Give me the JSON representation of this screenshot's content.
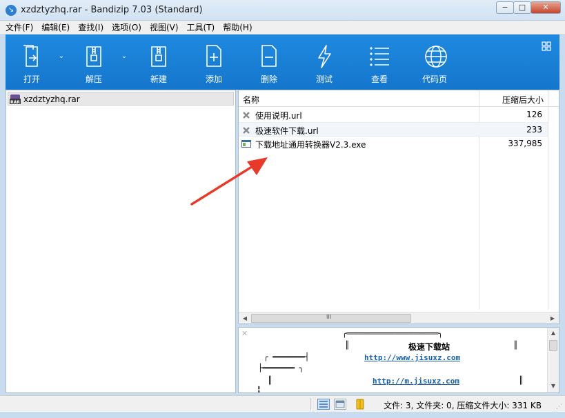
{
  "window": {
    "title": "xzdztyzhq.rar - Bandizip 7.03 (Standard)",
    "minimize": "−",
    "maximize": "□",
    "close": "✕"
  },
  "menu": [
    "文件(F)",
    "编辑(E)",
    "查找(I)",
    "选项(O)",
    "视图(V)",
    "工具(T)",
    "帮助(H)"
  ],
  "toolbar": {
    "open": "打开",
    "extract": "解压",
    "new": "新建",
    "add": "添加",
    "delete": "删除",
    "test": "测试",
    "view": "查看",
    "codepage": "代码页",
    "dropdown": "⌄"
  },
  "tree": {
    "archive": "xzdztyzhq.rar"
  },
  "files": {
    "columns": {
      "name": "名称",
      "size": "压缩后大小"
    },
    "rows": [
      {
        "name": "使用说明.url",
        "size": "126",
        "icon": "url-shortcut-icon"
      },
      {
        "name": "极速软件下载.url",
        "size": "233",
        "icon": "url-shortcut-icon"
      },
      {
        "name": "下载地址通用转换器V2.3.exe",
        "size": "337,985",
        "icon": "exe-window-icon"
      }
    ],
    "scroll_grip": "III"
  },
  "preview": {
    "close": "✕",
    "line1": "╭════════════════════╮",
    "line2a": "║",
    "title": "极速下载站",
    "line2b": "║",
    "line3a": "╭ ═══════┤",
    "link1": "http://www.jisuxz.com",
    "line4a": "├═══════ ╮",
    "line5a": "║",
    "link2": "http://m.jisuxz.com",
    "line5b": "║",
    "line6a": "╏"
  },
  "status": {
    "text": "文件: 3, 文件夹: 0, 压缩文件大小: 331 KB"
  },
  "colors": {
    "toolbar": "#1f8ae0",
    "arrow": "#e83a2a",
    "link": "#1a5fa6"
  }
}
